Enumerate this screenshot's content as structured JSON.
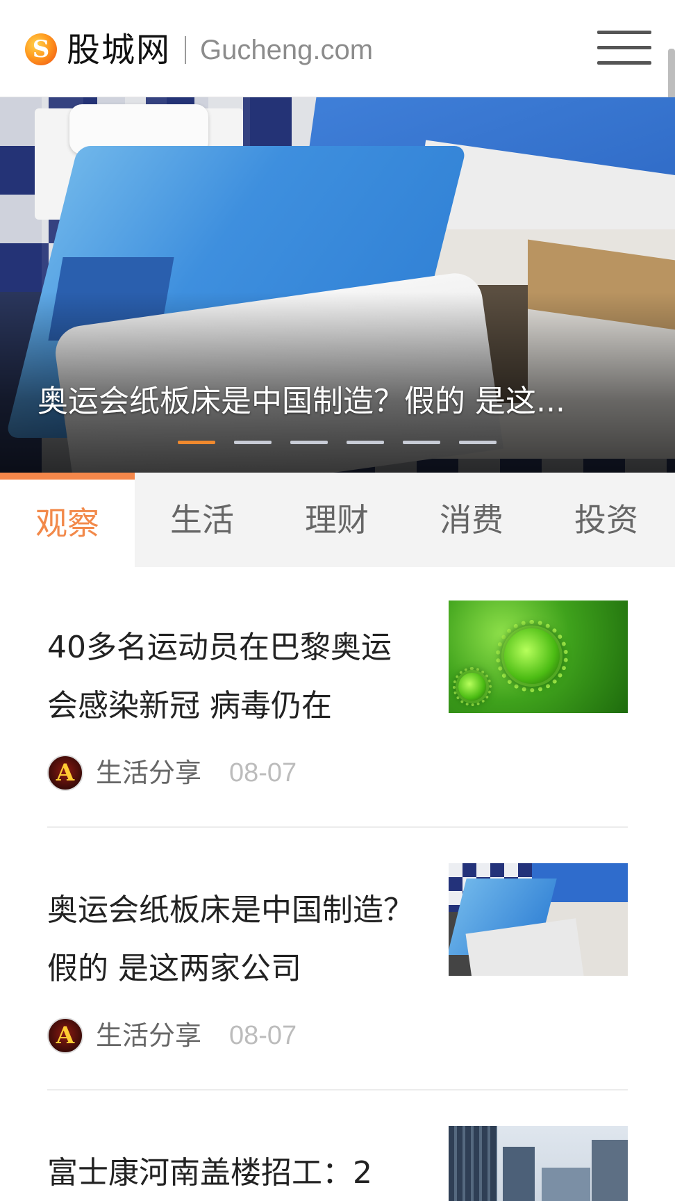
{
  "header": {
    "logo_glyph": "S",
    "site_name": "股城网",
    "site_domain": "Gucheng.com",
    "menu_icon": "hamburger-menu-icon"
  },
  "hero": {
    "caption": "奥运会纸板床是中国制造？假的 是这...",
    "slide_count": 6,
    "active_slide": 1
  },
  "tabs": [
    {
      "label": "观察",
      "active": true
    },
    {
      "label": "生活",
      "active": false
    },
    {
      "label": "理财",
      "active": false
    },
    {
      "label": "消费",
      "active": false
    },
    {
      "label": "投资",
      "active": false
    }
  ],
  "articles": [
    {
      "title": "40多名运动员在巴黎奥运会感染新冠 病毒仍在",
      "author": "生活分享",
      "date": "08-07",
      "thumb": "virus-image"
    },
    {
      "title": "奥运会纸板床是中国制造？假的 是这两家公司",
      "author": "生活分享",
      "date": "08-07",
      "thumb": "cardboard-beds-image"
    },
    {
      "title": "富士康河南盖楼招工：2",
      "author": "",
      "date": "",
      "thumb": "city-buildings-image"
    }
  ],
  "avatar_glyph": "A",
  "colors": {
    "accent": "#f5874a",
    "date": "#bcbcbc",
    "tab_bg": "#f3f3f3"
  }
}
